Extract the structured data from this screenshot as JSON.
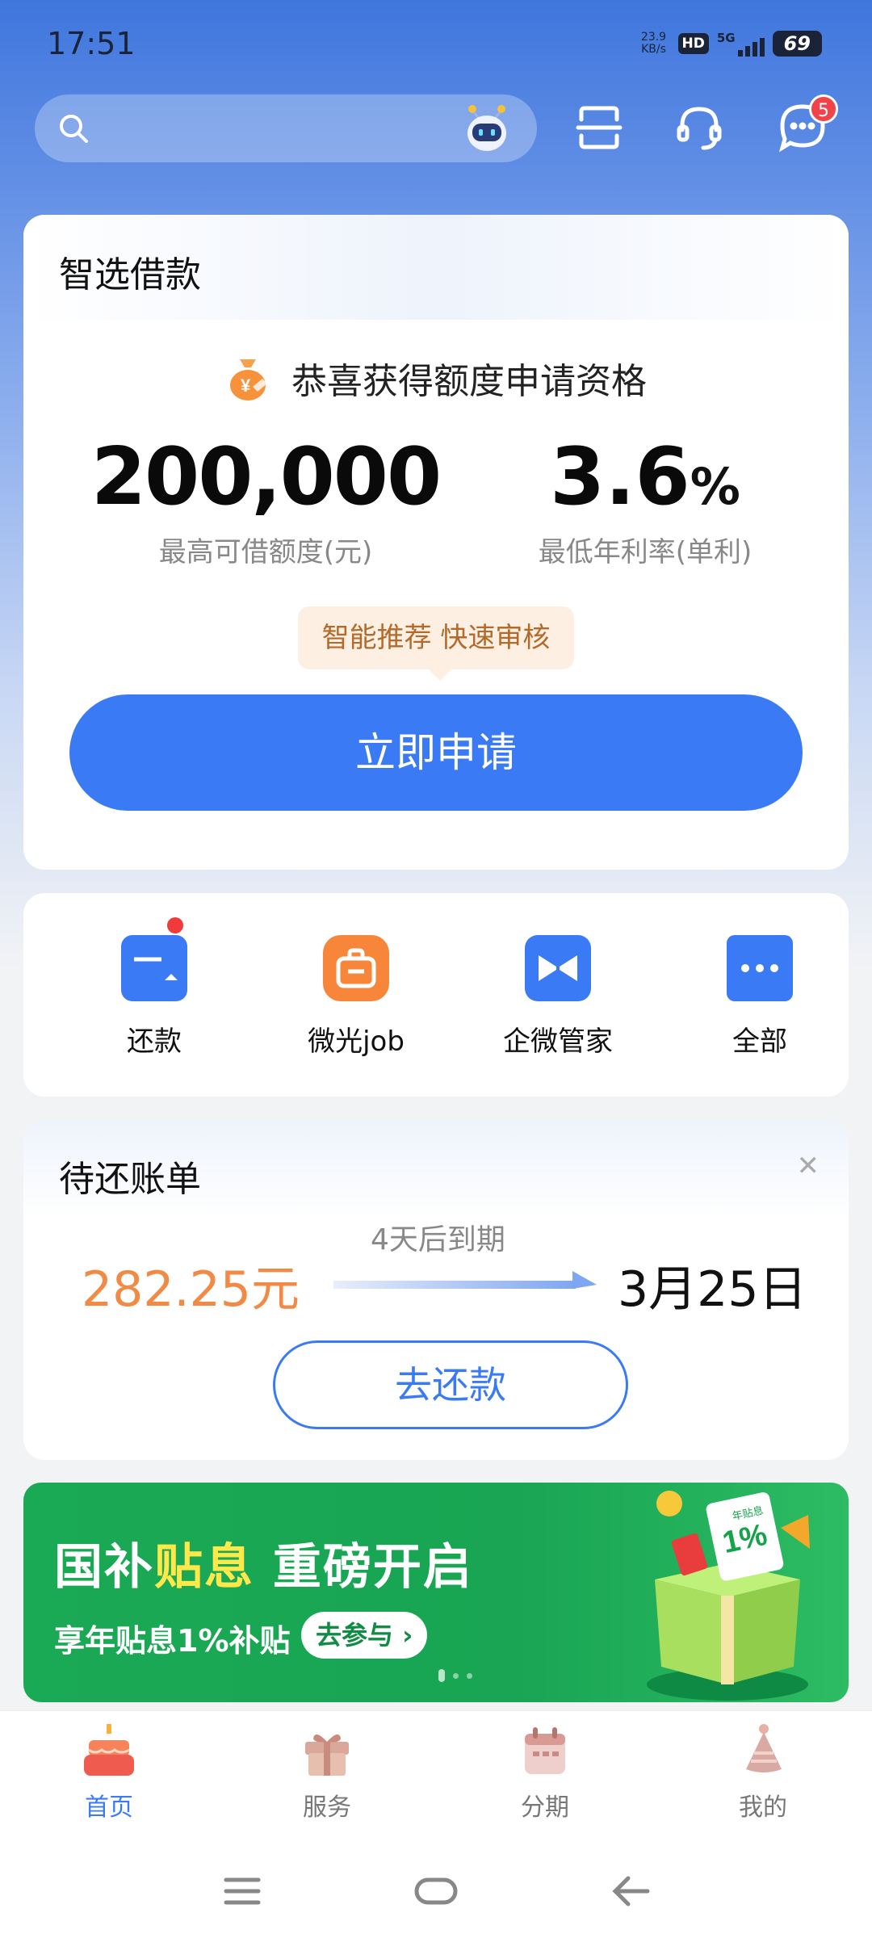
{
  "status_bar": {
    "time": "17:51",
    "net_speed_top": "23.9",
    "net_speed_bottom": "KB/s",
    "hd": "HD",
    "network": "5G",
    "battery": "69"
  },
  "top_bar": {
    "search_placeholder": "",
    "message_badge": "5"
  },
  "loan_card": {
    "title": "智选借款",
    "congrats": "恭喜获得额度申请资格",
    "amount": "200,000",
    "amount_label": "最高可借额度(元)",
    "rate": "3.6",
    "rate_unit": "%",
    "rate_label": "最低年利率(单利)",
    "tip": "智能推荐 快速审核",
    "apply_button": "立即申请"
  },
  "quick_actions": [
    {
      "label": "还款",
      "icon": "repay-card-icon",
      "color": "#3a7bf5"
    },
    {
      "label": "微光job",
      "icon": "briefcase-icon",
      "color": "#f7863a"
    },
    {
      "label": "企微管家",
      "icon": "bowtie-icon",
      "color": "#3a7bf5"
    },
    {
      "label": "全部",
      "icon": "more-dots-icon",
      "color": "#3a7bf5"
    }
  ],
  "bill_card": {
    "title": "待还账单",
    "due_text": "4天后到期",
    "amount": "282.25元",
    "due_date": "3月25日",
    "repay_button": "去还款"
  },
  "banner": {
    "headline_part1": "国补",
    "headline_highlight": "贴息",
    "headline_part2": " 重磅开启",
    "subline": "享年贴息1%补贴",
    "cta": "去参与",
    "gift_text": "1%",
    "gift_caption": "年贴息"
  },
  "tab_bar": [
    {
      "label": "首页",
      "icon": "cake-icon",
      "active": true
    },
    {
      "label": "服务",
      "icon": "gift-box-icon",
      "active": false
    },
    {
      "label": "分期",
      "icon": "calendar-icon",
      "active": false
    },
    {
      "label": "我的",
      "icon": "party-hat-icon",
      "active": false
    }
  ],
  "colors": {
    "accent": "#3a7bf5",
    "orange": "#f08a45",
    "banner_green": "#1aa955"
  }
}
